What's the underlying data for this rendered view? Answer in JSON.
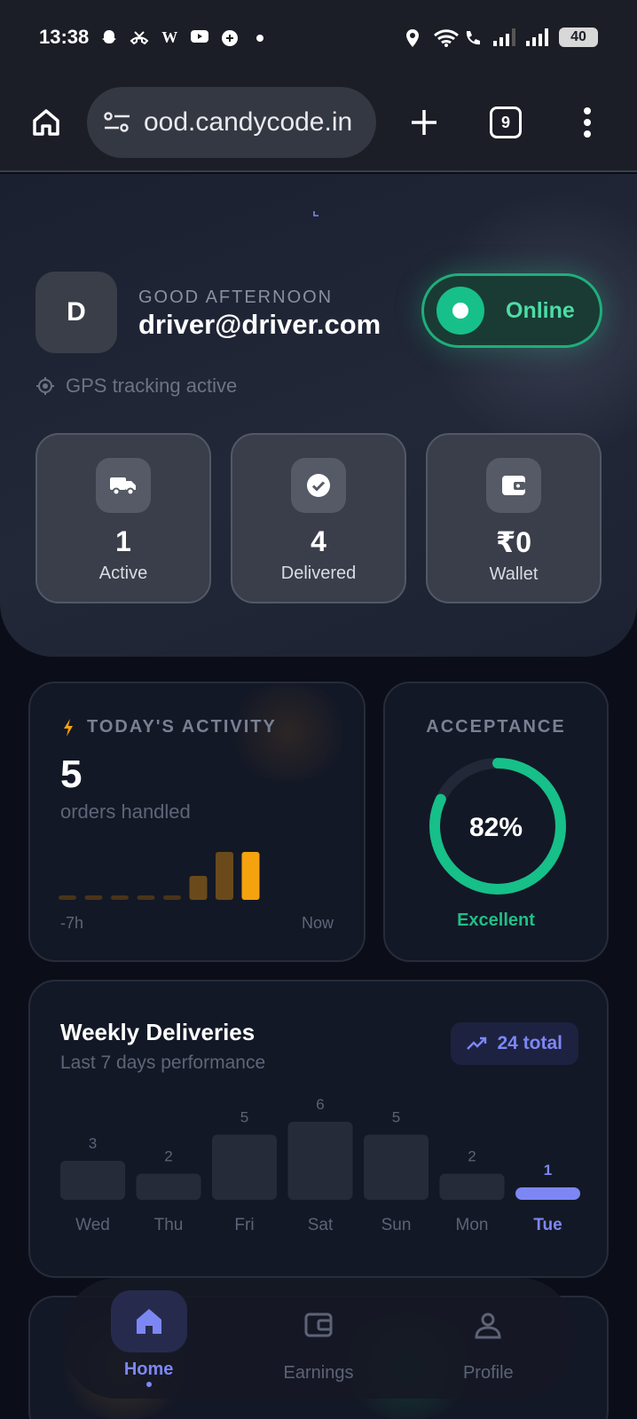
{
  "status_bar": {
    "time": "13:38",
    "battery": "40"
  },
  "browser": {
    "url": "ood.candycode.in",
    "tab_count": "9"
  },
  "header": {
    "avatar_initial": "D",
    "greeting": "GOOD AFTERNOON",
    "email": "driver@driver.com",
    "status_toggle": "Online",
    "gps_status": "GPS tracking active"
  },
  "stats": [
    {
      "icon": "truck-icon",
      "value": "1",
      "label": "Active"
    },
    {
      "icon": "check-circle-icon",
      "value": "4",
      "label": "Delivered"
    },
    {
      "icon": "wallet-icon",
      "value": "₹0",
      "label": "Wallet"
    }
  ],
  "activity": {
    "title": "TODAY'S ACTIVITY",
    "value": "5",
    "subtitle": "orders handled",
    "axis_start": "-7h",
    "axis_end": "Now"
  },
  "acceptance": {
    "title": "ACCEPTANCE",
    "value": "82%",
    "percent": 82,
    "rating": "Excellent"
  },
  "weekly": {
    "title": "Weekly Deliveries",
    "subtitle": "Last 7 days performance",
    "total_badge": "24 total"
  },
  "chart_data": {
    "type": "bar",
    "categories": [
      "Wed",
      "Thu",
      "Fri",
      "Sat",
      "Sun",
      "Mon",
      "Tue"
    ],
    "values": [
      3,
      2,
      5,
      6,
      5,
      2,
      1
    ],
    "highlight": "Tue"
  },
  "activity_chart": {
    "type": "bar",
    "values": [
      0,
      0,
      0,
      0,
      0,
      1,
      2,
      2
    ]
  },
  "nav": [
    {
      "icon": "home-icon",
      "label": "Home",
      "active": true
    },
    {
      "icon": "wallet-icon",
      "label": "Earnings",
      "active": false
    },
    {
      "icon": "user-icon",
      "label": "Profile",
      "active": false
    }
  ],
  "colors": {
    "accent": "#7d87f4",
    "online": "#16c088",
    "activity_bar": "#f5a20f",
    "activity_bar_dim": "#6a4a1a"
  }
}
